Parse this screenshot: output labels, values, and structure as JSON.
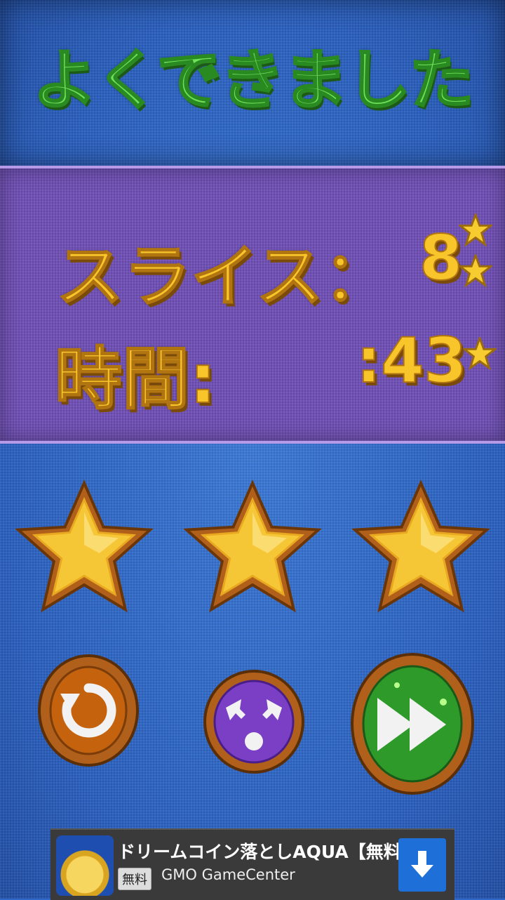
{
  "title": "よくできました",
  "stats": {
    "slice_label": "スライス：",
    "slice_value": "8",
    "time_label": "時間:",
    "time_value": ":43"
  },
  "rating": {
    "stars_earned": 3,
    "stars_total": 3
  },
  "buttons": {
    "retry": "retry-icon",
    "menu": "menu-icon",
    "next": "fast-forward-icon"
  },
  "ad": {
    "title": "ドリームコイン落としAQUA【無料…",
    "badge": "無料",
    "publisher": "GMO GameCenter",
    "download_icon": "download-arrow-icon"
  },
  "colors": {
    "title_green": "#6fe05a",
    "stat_gold": "#f8c52a",
    "panel_purple": "#7150b8",
    "bg_blue": "#2f68c8"
  }
}
